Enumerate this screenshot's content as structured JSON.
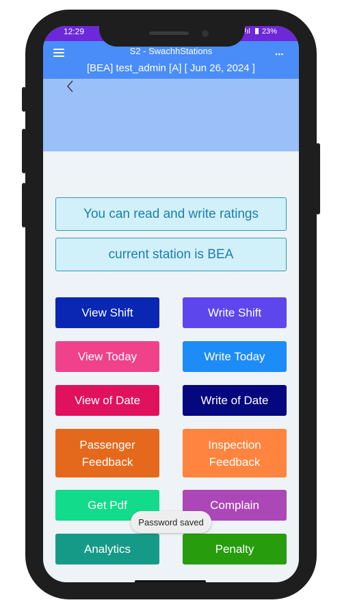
{
  "status_bar": {
    "time": "12:29",
    "signal": "ⵑıl",
    "battery": "23%"
  },
  "header": {
    "title": "S2 - SwachhStations",
    "subtitle": "[BEA] test_admin [A] [ Jun 26, 2024 ]",
    "menu_icon": "hamburger-menu-icon",
    "more_icon": "more-options-icon",
    "more_glyph": "•••",
    "color": "#4a8df8"
  },
  "banner": {
    "back_icon": "chevron-left-icon",
    "color": "#9bc0f9"
  },
  "info": {
    "permission": "You can read and write ratings",
    "station": "current station is BEA"
  },
  "actions": [
    {
      "label": "View Shift",
      "color": "#0a27b3"
    },
    {
      "label": "Write Shift",
      "color": "#5d47ec"
    },
    {
      "label": "View Today",
      "color": "#f0428a"
    },
    {
      "label": "Write Today",
      "color": "#1d8cf7"
    },
    {
      "label": "View of Date",
      "color": "#e0125e"
    },
    {
      "label": "Write of Date",
      "color": "#05077e"
    },
    {
      "label": "Passenger\nFeedback",
      "color": "#e5691c"
    },
    {
      "label": "Inspection\nFeedback",
      "color": "#ff8440"
    },
    {
      "label": "Get Pdf",
      "color": "#12dc8c"
    },
    {
      "label": "Complain",
      "color": "#ac47b8"
    },
    {
      "label": "Analytics",
      "color": "#169a88"
    },
    {
      "label": "Penalty",
      "color": "#279d0e"
    }
  ],
  "toast": {
    "text": "Password saved"
  }
}
